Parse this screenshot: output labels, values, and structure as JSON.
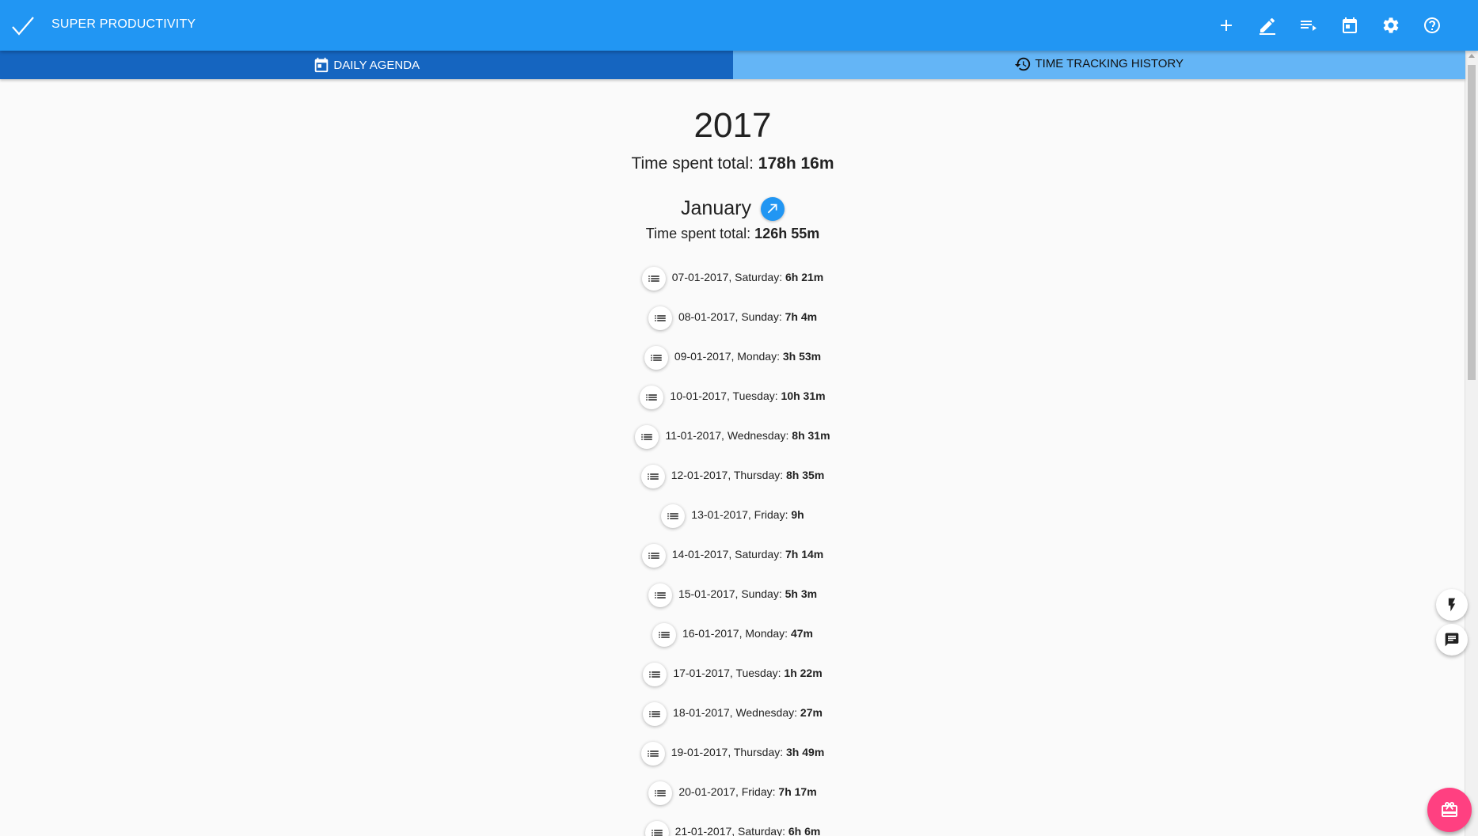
{
  "app": {
    "title": "SUPER PRODUCTIVITY",
    "accent_color": "#2196f3",
    "tab_active_color": "#1565c0",
    "tab_inactive_color": "#64b5f6",
    "fab_color": "#ff4081"
  },
  "toolbar": {
    "buttons": [
      {
        "name": "add-task-button",
        "icon": "plus-icon"
      },
      {
        "name": "edit-button",
        "icon": "pencil-icon"
      },
      {
        "name": "backlog-button",
        "icon": "playlist-add-icon"
      },
      {
        "name": "calendar-button",
        "icon": "calendar-icon"
      },
      {
        "name": "settings-button",
        "icon": "gear-icon"
      },
      {
        "name": "help-button",
        "icon": "help-circle-icon"
      }
    ]
  },
  "tabs": [
    {
      "label": "DAILY AGENDA",
      "icon": "calendar-icon",
      "active": false
    },
    {
      "label": "TIME TRACKING HISTORY",
      "icon": "history-icon",
      "active": true
    }
  ],
  "history": {
    "year": "2017",
    "year_total_label": "Time spent total:",
    "year_total_value": "178h 16m",
    "month": {
      "name": "January",
      "link_icon": "arrow-top-right-icon",
      "total_label": "Time spent total:",
      "total_value": "126h 55m",
      "days": [
        {
          "label": "07-01-2017, Saturday:",
          "time": "6h 21m"
        },
        {
          "label": "08-01-2017, Sunday:",
          "time": "7h 4m"
        },
        {
          "label": "09-01-2017, Monday:",
          "time": "3h 53m"
        },
        {
          "label": "10-01-2017, Tuesday:",
          "time": "10h 31m"
        },
        {
          "label": "11-01-2017, Wednesday:",
          "time": "8h 31m"
        },
        {
          "label": "12-01-2017, Thursday:",
          "time": "8h 35m"
        },
        {
          "label": "13-01-2017, Friday:",
          "time": "9h"
        },
        {
          "label": "14-01-2017, Saturday:",
          "time": "7h 14m"
        },
        {
          "label": "15-01-2017, Sunday:",
          "time": "5h 3m"
        },
        {
          "label": "16-01-2017, Monday:",
          "time": "47m"
        },
        {
          "label": "17-01-2017, Tuesday:",
          "time": "1h 22m"
        },
        {
          "label": "18-01-2017, Wednesday:",
          "time": "27m"
        },
        {
          "label": "19-01-2017, Thursday:",
          "time": "3h 49m"
        },
        {
          "label": "20-01-2017, Friday:",
          "time": "7h 17m"
        },
        {
          "label": "21-01-2017, Saturday:",
          "time": "6h 6m"
        }
      ]
    }
  },
  "fabs": [
    {
      "name": "quick-action-button",
      "icon": "flash-icon"
    },
    {
      "name": "notes-button",
      "icon": "comment-text-icon"
    },
    {
      "name": "main-fab-button",
      "icon": "gift-icon"
    }
  ]
}
